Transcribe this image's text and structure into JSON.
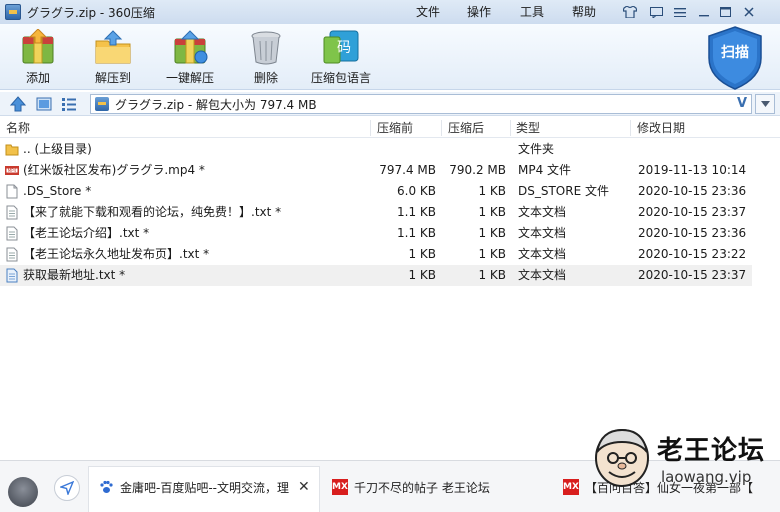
{
  "window": {
    "title": "グラグラ.zip - 360压缩",
    "menus": [
      "文件",
      "操作",
      "工具",
      "帮助"
    ]
  },
  "toolbar": {
    "buttons": [
      {
        "label": "添加",
        "icon": "add-archive-icon"
      },
      {
        "label": "解压到",
        "icon": "extract-to-icon"
      },
      {
        "label": "一键解压",
        "icon": "one-click-extract-icon"
      },
      {
        "label": "删除",
        "icon": "trash-icon"
      },
      {
        "label": "压缩包语言",
        "icon": "archive-language-icon"
      }
    ],
    "scan_label": "扫描",
    "language_glyph": "码"
  },
  "address": {
    "path": "グラグラ.zip - 解包大小为 797.4 MB",
    "search_letter": "V"
  },
  "columns": {
    "name": "名称",
    "compressed": "压缩前",
    "packed": "压缩后",
    "type": "类型",
    "modified": "修改日期"
  },
  "files": [
    {
      "name": ".. (上级目录)",
      "compressed": "",
      "packed": "",
      "type": "文件夹",
      "modified": "",
      "icon": "folder-icon"
    },
    {
      "name": "(红米饭社区发布)グラグラ.mp4 *",
      "compressed": "797.4 MB",
      "packed": "790.2 MB",
      "type": "MP4 文件",
      "modified": "2019-11-13 10:14",
      "icon": "video-file-icon"
    },
    {
      "name": ".DS_Store *",
      "compressed": "6.0 KB",
      "packed": "1 KB",
      "type": "DS_STORE 文件",
      "modified": "2020-10-15 23:36",
      "icon": "file-icon"
    },
    {
      "name": "【来了就能下载和观看的论坛，纯免费！】.txt *",
      "compressed": "1.1 KB",
      "packed": "1 KB",
      "type": "文本文档",
      "modified": "2020-10-15 23:37",
      "icon": "text-file-icon"
    },
    {
      "name": "【老王论坛介绍】.txt *",
      "compressed": "1.1 KB",
      "packed": "1 KB",
      "type": "文本文档",
      "modified": "2020-10-15 23:36",
      "icon": "text-file-icon"
    },
    {
      "name": "【老王论坛永久地址发布页】.txt *",
      "compressed": "1 KB",
      "packed": "1 KB",
      "type": "文本文档",
      "modified": "2020-10-15 23:22",
      "icon": "text-file-icon"
    },
    {
      "name": "获取最新地址.txt *",
      "compressed": "1 KB",
      "packed": "1 KB",
      "type": "文本文档",
      "modified": "2020-10-15 23:37",
      "icon": "text-file-icon"
    }
  ],
  "watermark": {
    "title": "老王论坛",
    "url": "laowang.vip"
  },
  "taskbar": {
    "tabs": [
      {
        "label": "金庸吧-百度贴吧--文明交流，理",
        "icon": "baidu-paw-icon"
      },
      {
        "label": "千刀不尽的帖子 老王论坛",
        "icon": "mx-icon",
        "badge": "MX"
      },
      {
        "label": "【百问百答】仙女一夜第一部【",
        "icon": "mx-icon",
        "badge": "MX"
      }
    ]
  },
  "colors": {
    "titlebar": "#cddcef",
    "toolbar": "#e3edf8",
    "scan_shield": "#2b74c9",
    "selected_row": "#f0f0f0",
    "mx_badge": "#d81e1e"
  }
}
